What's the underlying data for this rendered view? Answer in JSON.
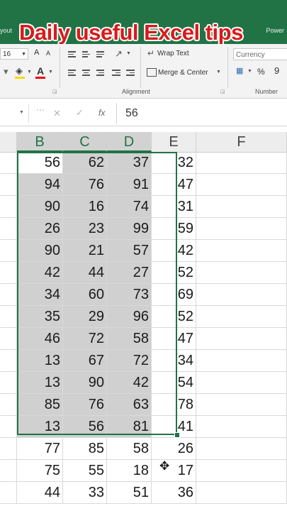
{
  "overlay": {
    "title": "Daily useful Excel tips"
  },
  "tabs": {
    "left": "yout",
    "right": "Power"
  },
  "ribbon": {
    "font_size": "16",
    "grow_glyph": "A",
    "shrink_glyph": "A",
    "font_color_glyph": "A",
    "wrap_text": "Wrap Text",
    "merge_center": "Merge & Center",
    "alignment_group": "Alignment",
    "number_format": "Currency",
    "percent": "%",
    "comma": "9",
    "number_group": "Number",
    "colors": {
      "fill": "#ffd800",
      "font": "#e00000",
      "excel_green": "#217346"
    },
    "icons": [
      "format-painter-icon",
      "fill-color-icon",
      "font-color-icon",
      "align-icon",
      "orientation-icon",
      "wrap-text-icon",
      "merge-icon",
      "accounting-icon",
      "percent-icon",
      "comma-icon",
      "dialog-launcher-icon"
    ]
  },
  "formula_bar": {
    "cancel": "✕",
    "enter": "✓",
    "fx": "fx",
    "value": "56"
  },
  "sheet": {
    "columns": [
      "B",
      "C",
      "D",
      "E",
      "F"
    ],
    "selected_columns": [
      "B",
      "C",
      "D"
    ],
    "selection": {
      "rows": 13,
      "active_cell": "56"
    },
    "rows": [
      [
        "56",
        "62",
        "37",
        "32"
      ],
      [
        "94",
        "76",
        "91",
        "47"
      ],
      [
        "90",
        "16",
        "74",
        "31"
      ],
      [
        "26",
        "23",
        "99",
        "59"
      ],
      [
        "90",
        "21",
        "57",
        "42"
      ],
      [
        "42",
        "44",
        "27",
        "52"
      ],
      [
        "34",
        "60",
        "73",
        "69"
      ],
      [
        "35",
        "29",
        "96",
        "52"
      ],
      [
        "46",
        "72",
        "58",
        "47"
      ],
      [
        "13",
        "67",
        "72",
        "34"
      ],
      [
        "13",
        "90",
        "42",
        "54"
      ],
      [
        "85",
        "76",
        "63",
        "78"
      ],
      [
        "13",
        "56",
        "81",
        "41"
      ],
      [
        "77",
        "85",
        "58",
        "26"
      ],
      [
        "75",
        "55",
        "18",
        "17"
      ],
      [
        "44",
        "33",
        "51",
        "36"
      ]
    ]
  }
}
